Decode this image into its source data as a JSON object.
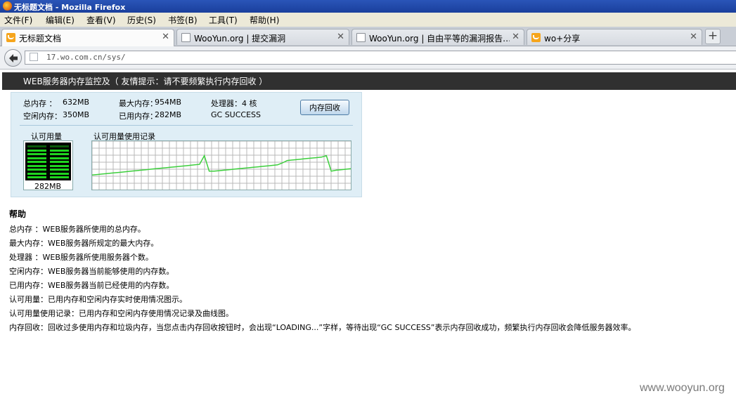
{
  "window": {
    "title": "无标题文档 - Mozilla Firefox"
  },
  "menu": [
    "文件(F)",
    "编辑(E)",
    "查看(V)",
    "历史(S)",
    "书签(B)",
    "工具(T)",
    "帮助(H)"
  ],
  "tabs": [
    {
      "label": "无标题文档",
      "active": true,
      "icon": "woo-favicon"
    },
    {
      "label": "WooYun.org | 提交漏洞",
      "active": false,
      "icon": "page-icon"
    },
    {
      "label": "WooYun.org | 自由平等的漏洞报告…",
      "active": false,
      "icon": "page-icon"
    },
    {
      "label": "wo+分享",
      "active": false,
      "icon": "woo-favicon"
    }
  ],
  "new_tab": "+",
  "address": {
    "url": "17.wo.com.cn/sys/"
  },
  "page": {
    "header": "WEB服务器内存监控及（ 友情提示：请不要频繁执行内存回收 ）",
    "stats": {
      "total_label": "总内存 ：",
      "total_value": "632MB",
      "max_label": "最大内存：",
      "max_value": "954MB",
      "cpu_label": "处理器：4 核",
      "free_label": "空闲内存：",
      "free_value": "350MB",
      "used_label": "已用内存：",
      "used_value": "282MB",
      "gc_status": "GC SUCCESS"
    },
    "gc_button": "内存回收",
    "gauge": {
      "title": "认可用量",
      "value_text": "282MB",
      "fill_fraction": 0.55
    },
    "history": {
      "title": "认可用量使用记录"
    }
  },
  "chart_data": {
    "type": "line",
    "title": "认可用量使用记录",
    "grid": true,
    "ylim": [
      0,
      1
    ],
    "series": [
      {
        "values": [
          0.3,
          0.31,
          0.32,
          0.33,
          0.34,
          0.35,
          0.36,
          0.37,
          0.38,
          0.39,
          0.4,
          0.41,
          0.42,
          0.43,
          0.44,
          0.45,
          0.46,
          0.47,
          0.48,
          0.49,
          0.5,
          0.51,
          0.52,
          0.7,
          0.38,
          0.38,
          0.39,
          0.4,
          0.41,
          0.42,
          0.43,
          0.44,
          0.45,
          0.46,
          0.47,
          0.48,
          0.49,
          0.5,
          0.51,
          0.55,
          0.6,
          0.61,
          0.62,
          0.63,
          0.64,
          0.65,
          0.66,
          0.67,
          0.7,
          0.38,
          0.4,
          0.41,
          0.42,
          0.43
        ]
      }
    ]
  },
  "help": {
    "title": "帮助",
    "lines": [
      "总内存 ：WEB服务器所使用的总内存。",
      "最大内存：WEB服务器所规定的最大内存。",
      "处理器 ：WEB服务器所使用服务器个数。",
      "空闲内存：WEB服务器当前能够使用的内存数。",
      "已用内存：WEB服务器当前已经使用的内存数。",
      "认可用量：已用内存和空闲内存实时使用情况图示。",
      "认可用量使用记录：已用内存和空闲内存使用情况记录及曲线图。",
      "内存回收：回收过多使用内存和垃圾内存，当您点击内存回收按钮时，会出现“LOADING...”字样，等待出现“GC SUCCESS”表示内存回收成功，频繁执行内存回收会降低服务器效率。"
    ]
  },
  "watermark": "www.wooyun.org",
  "colors": {
    "gauge_green": "#1fd61f",
    "line_green": "#3ccf3c",
    "header_bg": "#303030"
  }
}
